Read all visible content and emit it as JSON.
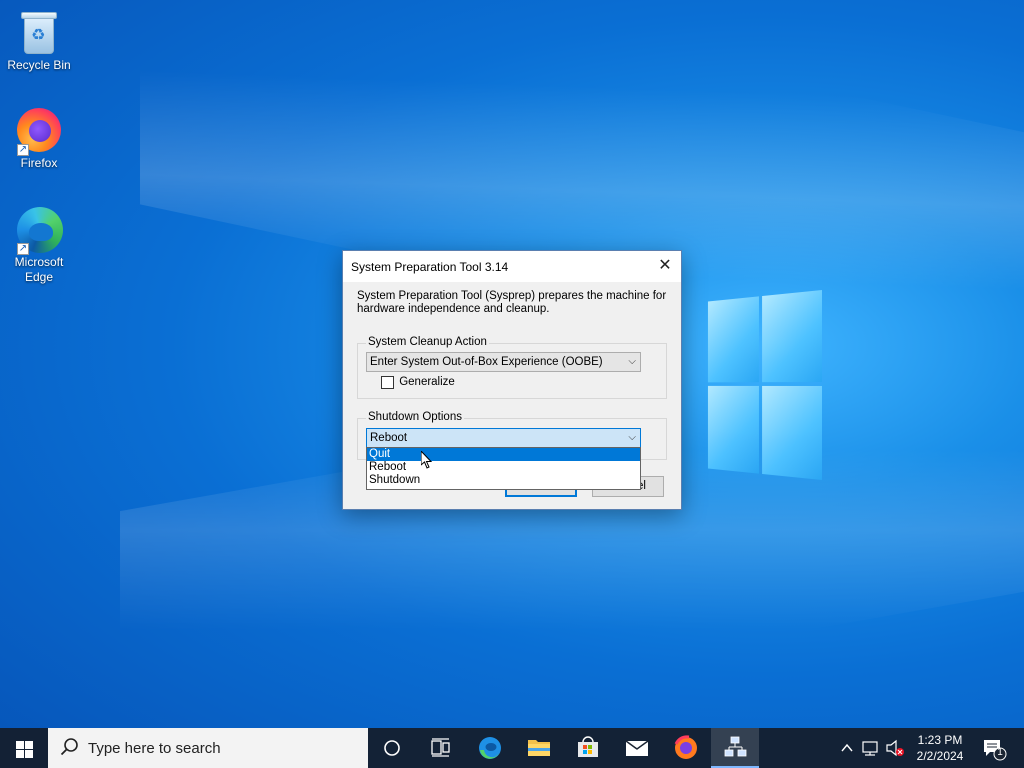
{
  "desktop": {
    "icons": [
      {
        "label": "Recycle Bin"
      },
      {
        "label": "Firefox"
      },
      {
        "label": "Microsoft Edge"
      }
    ]
  },
  "dialog": {
    "title": "System Preparation Tool 3.14",
    "close_glyph": "✕",
    "description": "System Preparation Tool (Sysprep) prepares the machine for hardware independence and cleanup.",
    "cleanup": {
      "legend": "System Cleanup Action",
      "selected": "Enter System Out-of-Box Experience (OOBE)"
    },
    "generalize": {
      "label": "Generalize",
      "checked": false
    },
    "shutdown": {
      "legend": "Shutdown Options",
      "selected": "Reboot",
      "options": [
        "Quit",
        "Reboot",
        "Shutdown"
      ],
      "highlighted": "Quit"
    },
    "buttons": {
      "ok": "OK",
      "cancel": "Cancel"
    }
  },
  "taskbar": {
    "search_placeholder": "Type here to search",
    "clock": {
      "time": "1:23 PM",
      "date": "2/2/2024"
    },
    "notification_count": "1"
  }
}
